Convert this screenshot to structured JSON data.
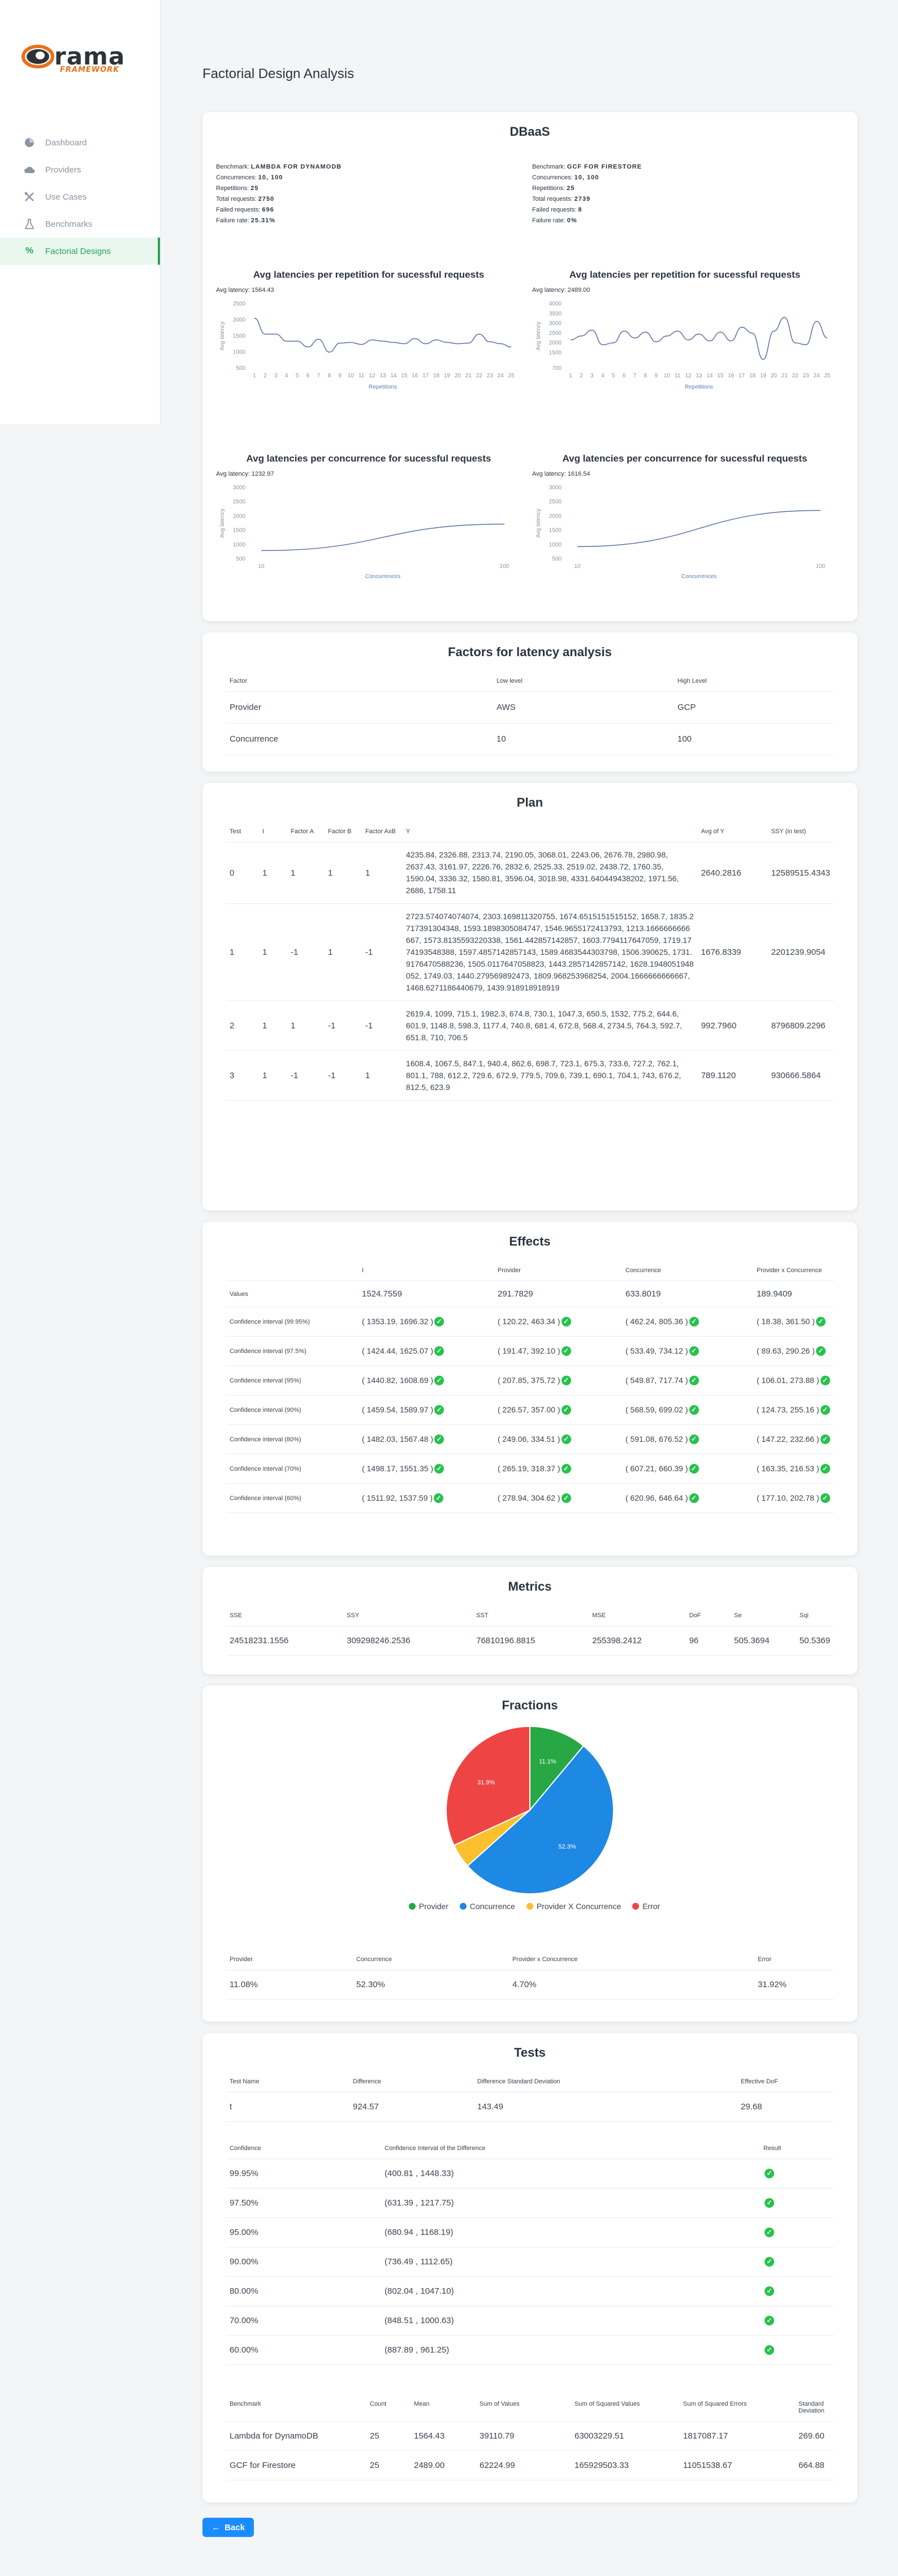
{
  "logo": {
    "text": "rama",
    "sub": "FRAMEWORK"
  },
  "nav": [
    {
      "label": "Dashboard",
      "icon": "pie-chart-icon"
    },
    {
      "label": "Providers",
      "icon": "cloud-icon"
    },
    {
      "label": "Use Cases",
      "icon": "tools-icon"
    },
    {
      "label": "Benchmarks",
      "icon": "flask-icon"
    },
    {
      "label": "Factorial Designs",
      "icon": "percent-icon",
      "active": true
    }
  ],
  "page_title": "Factorial Design Analysis",
  "dbaas": {
    "title": "DBaaS",
    "left": {
      "benchmark_label": "Benchmark:",
      "benchmark": "LAMBDA FOR DYNAMODB",
      "conc_label": "Concurrences:",
      "conc": "10, 100",
      "rep_label": "Repetitions:",
      "rep": "25",
      "total_label": "Total requests:",
      "total": "2750",
      "failed_label": "Failed requests:",
      "failed": "696",
      "rate_label": "Failure rate:",
      "rate": "25.31%"
    },
    "right": {
      "benchmark_label": "Benchmark:",
      "benchmark": "GCF FOR FIRESTORE",
      "conc_label": "Concurrences:",
      "conc": "10, 100",
      "rep_label": "Repetitions:",
      "rep": "25",
      "total_label": "Total requests:",
      "total": "2739",
      "failed_label": "Failed requests:",
      "failed": "8",
      "rate_label": "Failure rate:",
      "rate": "0%"
    }
  },
  "chart_data": [
    {
      "type": "line",
      "title": "Avg latencies per repetition for sucessful requests",
      "subtitle": "Avg latency: 1564.43",
      "xlabel": "Repetitions",
      "ylabel": "Avg latency",
      "x": [
        1,
        2,
        3,
        4,
        5,
        6,
        7,
        8,
        9,
        10,
        11,
        12,
        13,
        14,
        15,
        16,
        17,
        18,
        19,
        20,
        21,
        22,
        23,
        24,
        25
      ],
      "values": [
        2050,
        1560,
        1560,
        1340,
        1340,
        1160,
        1400,
        1000,
        1280,
        1300,
        1240,
        1380,
        1340,
        1300,
        1260,
        1420,
        1260,
        1380,
        1300,
        1260,
        1280,
        1560,
        1320,
        1260,
        1160
      ],
      "yticks": [
        500,
        1000,
        1500,
        2000,
        2500
      ],
      "ylim": [
        500,
        2500
      ]
    },
    {
      "type": "line",
      "title": "Avg latencies per repetition for sucessful requests",
      "subtitle": "Avg latency: 2489.00",
      "xlabel": "Repetitions",
      "ylabel": "Avg latency",
      "x": [
        1,
        2,
        3,
        4,
        5,
        6,
        7,
        8,
        9,
        10,
        11,
        12,
        13,
        14,
        15,
        16,
        17,
        18,
        19,
        20,
        21,
        22,
        23,
        24,
        25
      ],
      "values": [
        2150,
        2350,
        2650,
        1900,
        2000,
        2600,
        2250,
        2550,
        2050,
        2350,
        2600,
        2150,
        2450,
        2100,
        2550,
        2100,
        2800,
        2500,
        1150,
        2600,
        3300,
        2000,
        1900,
        3100,
        2250
      ],
      "yticks": [
        700,
        1500,
        2000,
        2500,
        3000,
        3500,
        4000
      ],
      "ylim": [
        700,
        4000
      ]
    },
    {
      "type": "line",
      "title": "Avg latencies per concurrence for sucessful requests",
      "subtitle": "Avg latency: 1232.97",
      "xlabel": "Concurrences",
      "ylabel": "Avg latency",
      "x": [
        10,
        100
      ],
      "values": [
        790,
        1720
      ],
      "yticks": [
        500,
        1000,
        1500,
        2000,
        2500,
        3000
      ],
      "ylim": [
        500,
        3000
      ]
    },
    {
      "type": "line",
      "title": "Avg latencies per concurrence for sucessful requests",
      "subtitle": "Avg latency: 1616.54",
      "xlabel": "Concurrences",
      "ylabel": "Avg latency",
      "x": [
        10,
        100
      ],
      "values": [
        930,
        2200
      ],
      "yticks": [
        500,
        1000,
        1500,
        2000,
        2500,
        3000
      ],
      "ylim": [
        500,
        3000
      ]
    }
  ],
  "factors": {
    "title": "Factors for latency analysis",
    "headers": [
      "Factor",
      "Low level",
      "High Level"
    ],
    "rows": [
      [
        "Provider",
        "AWS",
        "GCP"
      ],
      [
        "Concurrence",
        "10",
        "100"
      ]
    ]
  },
  "plan": {
    "title": "Plan",
    "headers": [
      "Test",
      "I",
      "Factor A",
      "Factor B",
      "Factor AxB",
      "Y",
      "Avg of Y",
      "SSY (in test)"
    ],
    "rows": [
      [
        "0",
        "1",
        "1",
        "1",
        "1",
        "4235.84, 2326.88, 2313.74, 2190.05, 3068.01, 2243.06, 2676.78, 2980.98, 2637.43, 3161.97, 2226.76, 2832.6, 2525.33, 2519.02, 2438.72, 1760.35, 1590.04, 3336.32, 1580.81, 3596.04, 3018.98, 4331.640449438202, 1971.56, 2686, 1758.11",
        "2640.2816",
        "12589515.4343"
      ],
      [
        "1",
        "1",
        "-1",
        "1",
        "-1",
        "2723.574074074074, 2303.169811320755, 1674.6515151515152, 1658.7, 1835.2717391304348, 1593.1898305084747, 1546.9655172413793, 1213.1666666666667, 1573.8135593220338, 1561.442857142857, 1603.7794117647059, 1719.1774193548388, 1597.4857142857143, 1589.4683544303798, 1506.390625, 1731.9176470588236, 1505.0117647058823, 1443.2857142857142, 1628.1948051948052, 1749.03, 1440.279569892473, 1809.968253968254, 2004.1666666666667, 1468.6271186440679, 1439.918918918919",
        "1676.8339",
        "2201239.9054"
      ],
      [
        "2",
        "1",
        "1",
        "-1",
        "-1",
        "2619.4, 1099, 715.1, 1982.3, 674.8, 730.1, 1047.3, 650.5, 1532, 775.2, 644.6, 601.9, 1148.8, 598.3, 1177.4, 740.8, 681.4, 672.8, 568.4, 2734.5, 764.3, 592.7, 651.8, 710, 706.5",
        "992.7960",
        "8796809.2296"
      ],
      [
        "3",
        "1",
        "-1",
        "-1",
        "1",
        "1608.4, 1067.5, 847.1, 940.4, 862.6, 698.7, 723.1, 675.3, 733.6, 727.2, 762.1, 801.1, 788, 612.2, 729.6, 672.9, 779.5, 709.6, 739.1, 690.1, 704.1, 743, 676.2, 812.5, 623.9",
        "789.1120",
        "930666.5864"
      ]
    ]
  },
  "effects": {
    "title": "Effects",
    "headers": [
      "",
      "I",
      "Provider",
      "Concurrence",
      "Provider x Concurrence"
    ],
    "values_label": "Values",
    "values": [
      "1524.7559",
      "291.7829",
      "633.8019",
      "189.9409"
    ],
    "rows": [
      {
        "label": "Confidence interval (99.95%)",
        "cells": [
          "( 1353.19, 1696.32 )",
          "( 120.22, 463.34 )",
          "( 462.24, 805.36 )",
          "( 18.38, 361.50 )"
        ]
      },
      {
        "label": "Confidence interval (97.5%)",
        "cells": [
          "( 1424.44, 1625.07 )",
          "( 191.47, 392.10 )",
          "( 533.49, 734.12 )",
          "( 89.63, 290.26 )"
        ]
      },
      {
        "label": "Confidence interval (95%)",
        "cells": [
          "( 1440.82, 1608.69 )",
          "( 207.85, 375.72 )",
          "( 549.87, 717.74 )",
          "( 106.01, 273.88 )"
        ]
      },
      {
        "label": "Confidence interval (90%)",
        "cells": [
          "( 1459.54, 1589.97 )",
          "( 226.57, 357.00 )",
          "( 568.59, 699.02 )",
          "( 124.73, 255.16 )"
        ]
      },
      {
        "label": "Confidence interval (80%)",
        "cells": [
          "( 1482.03, 1567.48 )",
          "( 249.06, 334.51 )",
          "( 591.08, 676.52 )",
          "( 147.22, 232.66 )"
        ]
      },
      {
        "label": "Confidence interval (70%)",
        "cells": [
          "( 1498.17, 1551.35 )",
          "( 265.19, 318.37 )",
          "( 607.21, 660.39 )",
          "( 163.35, 216.53 )"
        ]
      },
      {
        "label": "Confidence interval (60%)",
        "cells": [
          "( 1511.92, 1537.59 )",
          "( 278.94, 304.62 )",
          "( 620.96, 646.64 )",
          "( 177.10, 202.78 )"
        ]
      }
    ]
  },
  "metrics": {
    "title": "Metrics",
    "headers": [
      "SSE",
      "SSY",
      "SST",
      "MSE",
      "DoF",
      "Se",
      "Sqi"
    ],
    "values": [
      "24518231.1556",
      "309298246.2536",
      "76810196.8815",
      "255398.2412",
      "96",
      "505.3694",
      "50.5369"
    ]
  },
  "fractions": {
    "title": "Fractions",
    "slices": [
      {
        "name": "Provider",
        "value": 11.08,
        "label": "11.1%",
        "color": "#28a745"
      },
      {
        "name": "Concurrence",
        "value": 52.3,
        "label": "52.3%",
        "color": "#1e88e5"
      },
      {
        "name": "Provider X Concurrence",
        "value": 4.7,
        "label": "",
        "color": "#fbc02d"
      },
      {
        "name": "Error",
        "value": 31.92,
        "label": "31.9%",
        "color": "#ef4444"
      }
    ],
    "headers": [
      "Provider",
      "Concurrence",
      "Provider x Concurrence",
      "Error"
    ],
    "values": [
      "11.08%",
      "52.30%",
      "4.70%",
      "31.92%"
    ]
  },
  "tests": {
    "title": "Tests",
    "headers1": [
      "Test Name",
      "Difference",
      "Difference Standard Deviation",
      "Effective DoF"
    ],
    "row1": [
      "t",
      "924.57",
      "143.49",
      "29.68"
    ],
    "headers2": [
      "Confidence",
      "Confidence Interval of the Difference",
      "Result"
    ],
    "rows2": [
      [
        "99.95%",
        "(400.81 , 1448.33)"
      ],
      [
        "97.50%",
        "(631.39 , 1217.75)"
      ],
      [
        "95.00%",
        "(680.94 , 1168.19)"
      ],
      [
        "90.00%",
        "(736.49 , 1112.65)"
      ],
      [
        "80.00%",
        "(802.04 , 1047.10)"
      ],
      [
        "70.00%",
        "(848.51 , 1000.63)"
      ],
      [
        "60.00%",
        "(887.89 , 961.25)"
      ]
    ],
    "headers3": [
      "Benchmark",
      "Count",
      "Mean",
      "Sum of Values",
      "Sum of Squared Values",
      "Sum of Squared Errors",
      "Standard Deviation"
    ],
    "rows3": [
      [
        "Lambda for DynamoDB",
        "25",
        "1564.43",
        "39110.79",
        "63003229.51",
        "1817087.17",
        "269.60"
      ],
      [
        "GCF for Firestore",
        "25",
        "2489.00",
        "62224.99",
        "165929503.33",
        "11051538.67",
        "664.88"
      ]
    ]
  },
  "back_label": "Back"
}
